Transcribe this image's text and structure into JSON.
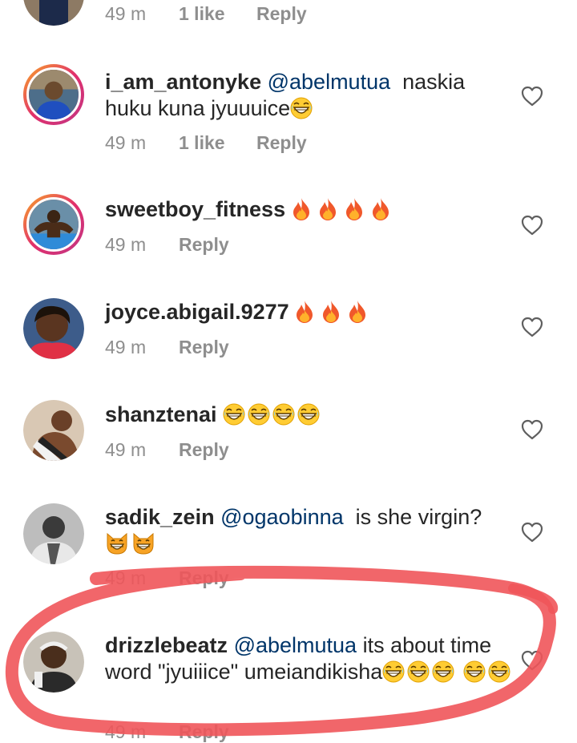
{
  "comments": [
    {
      "user": "",
      "text": "",
      "time": "49 m",
      "likes": "1 like",
      "reply": "Reply"
    },
    {
      "user": "i_am_antonyke",
      "mention": "@abelmutua",
      "text": "naskia huku kuna jyuuuice",
      "time": "49 m",
      "likes": "1 like",
      "reply": "Reply"
    },
    {
      "user": "sweetboy_fitness",
      "text": "",
      "time": "49 m",
      "reply": "Reply"
    },
    {
      "user": "joyce.abigail.9277",
      "text": "",
      "time": "49 m",
      "reply": "Reply"
    },
    {
      "user": "shanztenai",
      "text": "",
      "time": "49 m",
      "reply": "Reply"
    },
    {
      "user": "sadik_zein",
      "mention": "@ogaobinna",
      "text": "is she virgin?",
      "time": "49 m",
      "reply": "Reply"
    },
    {
      "user": "drizzlebeatz",
      "mention": "@abelmutua",
      "text": "its about time word \"jyuiiice\" umeiandikisha",
      "time": "49 m",
      "reply": "Reply"
    }
  ],
  "icons": {
    "like": "heart-icon",
    "laugh": "grinning-emoji",
    "fire": "fire-emoji",
    "cat": "grinning-cat-emoji"
  },
  "colors": {
    "mention": "#003569",
    "meta": "#8e8e8e",
    "marker": "#f0555a"
  }
}
